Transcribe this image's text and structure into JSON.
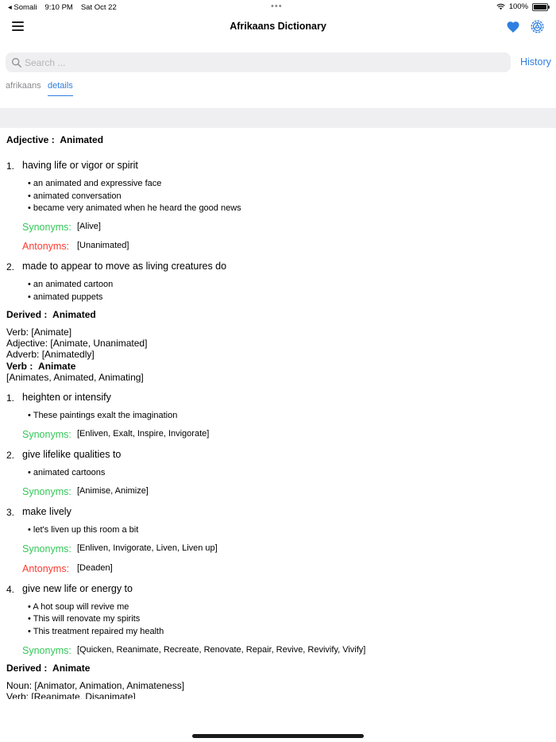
{
  "status": {
    "carrier": "◂ Somali",
    "time": "9:10 PM",
    "date": "Sat Oct 22",
    "battery": "100%"
  },
  "nav": {
    "title": "Afrikaans Dictionary"
  },
  "search": {
    "placeholder": "Search ...",
    "history": "History"
  },
  "tabs": {
    "afrikaans": "afrikaans",
    "details": "details"
  },
  "entry": {
    "adj_label": "Adjective :",
    "adj_word": "Animated",
    "s1": {
      "num": "1.",
      "def": "having life or vigor or spirit",
      "ex1": "an animated and expressive face",
      "ex2": "animated conversation",
      "ex3": "became very animated when he heard the good news",
      "syn_label": "Synonyms:",
      "syn": "[Alive]",
      "ant_label": "Antonyms:",
      "ant": "[Unanimated]"
    },
    "s2": {
      "num": "2.",
      "def": "made to appear to move as living creatures do",
      "ex1": "an animated cartoon",
      "ex2": "animated puppets"
    },
    "derived1": {
      "label": "Derived :",
      "word": "Animated",
      "verb": "Verb:  [Animate]",
      "adjective": "Adjective:  [Animate, Unanimated]",
      "adverb": "Adverb:  [Animatedly]"
    },
    "verb_label": "Verb :",
    "verb_word": "Animate",
    "verb_forms": "[Animates, Animated, Animating]",
    "v1": {
      "num": "1.",
      "def": "heighten or intensify",
      "ex1": "These paintings exalt the imagination",
      "syn_label": "Synonyms:",
      "syn": "[Enliven, Exalt, Inspire, Invigorate]"
    },
    "v2": {
      "num": "2.",
      "def": "give lifelike qualities to",
      "ex1": "animated cartoons",
      "syn_label": "Synonyms:",
      "syn": "[Animise, Animize]"
    },
    "v3": {
      "num": "3.",
      "def": "make lively",
      "ex1": "let's liven up this room a bit",
      "syn_label": "Synonyms:",
      "syn": "[Enliven, Invigorate, Liven, Liven up]",
      "ant_label": "Antonyms:",
      "ant": "[Deaden]"
    },
    "v4": {
      "num": "4.",
      "def": "give new life or energy to",
      "ex1": "A hot soup will revive me",
      "ex2": "This will renovate my spirits",
      "ex3": "This treatment repaired my health",
      "syn_label": "Synonyms:",
      "syn": "[Quicken, Reanimate, Recreate, Renovate, Repair, Revive, Revivify, Vivify]"
    },
    "derived2": {
      "label": "Derived :",
      "word": "Animate",
      "noun": "Noun:  [Animator, Animation, Animateness]",
      "verb": "Verb:  [Reanimate, Disanimate]"
    }
  },
  "colors": {
    "accent": "#2f7fe0",
    "synonym": "#34c759",
    "antonym": "#ff3b30",
    "band": "#efeff1"
  },
  "icons": {
    "menu": "menu-icon",
    "heart": "heart-icon",
    "gear": "gear-icon",
    "search": "search-icon"
  }
}
